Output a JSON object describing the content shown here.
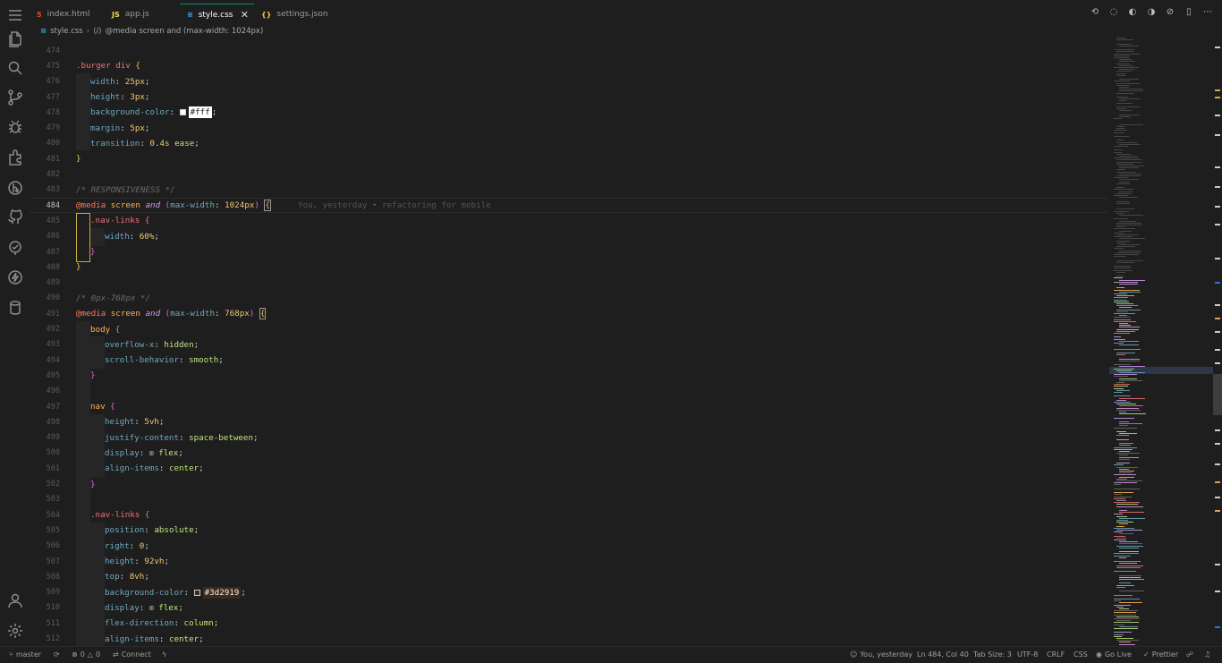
{
  "tabs": [
    {
      "label": "index.html",
      "icon": "html-file-icon",
      "icon_color": "#e44d26"
    },
    {
      "label": "app.js",
      "icon": "js-file-icon",
      "icon_color": "#f0db4f"
    },
    {
      "label": "style.css",
      "icon": "css-file-icon",
      "icon_color": "#42a5f5"
    },
    {
      "label": "settings.json",
      "icon": "json-file-icon",
      "icon_color": "#f5c542"
    }
  ],
  "breadcrumb": {
    "file": "style.css",
    "symbol": "@media screen and (max-width: 1024px)"
  },
  "editor": {
    "blame": "You, yesterday • refactoring for mobile",
    "lines": [
      {
        "n": "474"
      },
      {
        "n": "475",
        "t": ".burger div {"
      },
      {
        "n": "476",
        "t": "width: 25px;"
      },
      {
        "n": "477",
        "t": "height: 3px;"
      },
      {
        "n": "478",
        "t": "background-color: #fff;"
      },
      {
        "n": "479",
        "t": "margin: 5px;"
      },
      {
        "n": "480",
        "t": "transition: 0.4s ease;"
      },
      {
        "n": "481",
        "t": "}"
      },
      {
        "n": "482"
      },
      {
        "n": "483",
        "t": "/* RESPONSIVENESS */"
      },
      {
        "n": "484",
        "t": "@media screen and (max-width: 1024px) {"
      },
      {
        "n": "485",
        "t": ".nav-links {"
      },
      {
        "n": "486",
        "t": "width: 60%;"
      },
      {
        "n": "487",
        "t": "}"
      },
      {
        "n": "488",
        "t": "}"
      },
      {
        "n": "489"
      },
      {
        "n": "490",
        "t": "/* 0px-768px */"
      },
      {
        "n": "491",
        "t": "@media screen and (max-width: 768px) {"
      },
      {
        "n": "492",
        "t": "body {"
      },
      {
        "n": "493",
        "t": "overflow-x: hidden;"
      },
      {
        "n": "494",
        "t": "scroll-behavior: smooth;"
      },
      {
        "n": "495",
        "t": "}"
      },
      {
        "n": "496"
      },
      {
        "n": "497",
        "t": "nav {"
      },
      {
        "n": "498",
        "t": "height: 5vh;"
      },
      {
        "n": "499",
        "t": "justify-content: space-between;"
      },
      {
        "n": "500",
        "t": "display: flex;"
      },
      {
        "n": "501",
        "t": "align-items: center;"
      },
      {
        "n": "502",
        "t": "}"
      },
      {
        "n": "503"
      },
      {
        "n": "504",
        "t": ".nav-links {"
      },
      {
        "n": "505",
        "t": "position: absolute;"
      },
      {
        "n": "506",
        "t": "right: 0;"
      },
      {
        "n": "507",
        "t": "height: 92vh;"
      },
      {
        "n": "508",
        "t": "top: 8vh;"
      },
      {
        "n": "509",
        "t": "background-color: #3d2919;"
      },
      {
        "n": "510",
        "t": "display: flex;"
      },
      {
        "n": "511",
        "t": "flex-direction: column;"
      },
      {
        "n": "512",
        "t": "align-items: center;"
      }
    ],
    "current_line": "484"
  },
  "statusbar": {
    "branch": "master",
    "errors": "0",
    "warnings": "0",
    "connect": "Connect",
    "blame": "You, yesterday",
    "position": "Ln 484, Col 40",
    "tab_size": "Tab Size: 3",
    "encoding": "UTF-8",
    "eol": "CRLF",
    "language": "CSS",
    "go_live": "Go Live",
    "prettier": "Prettier"
  },
  "colors": {
    "accent": "#0e8a76",
    "editor_bg": "#1e1e1e",
    "swatch_white": "#ffffff",
    "swatch_brown": "#3d2919"
  }
}
